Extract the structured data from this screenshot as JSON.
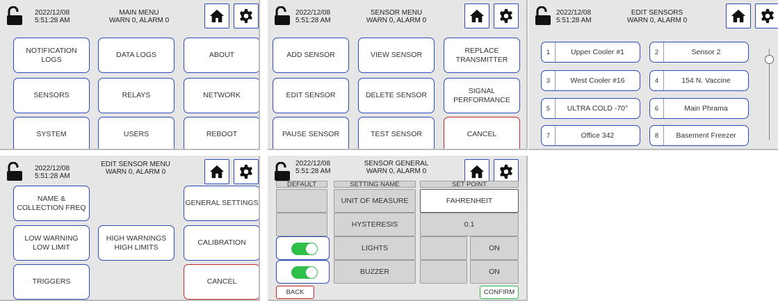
{
  "colors": {
    "accent": "#2d4bb8",
    "cancel_border": "#c62828",
    "toggle_on": "#2fbf4a",
    "panel_bg": "#e6e6e6"
  },
  "icons": {
    "lock": "unlocked-padlock-icon",
    "home": "home-icon",
    "settings": "gear-icon"
  },
  "status": {
    "date": "2022/12/08",
    "time": "5:51:28 AM",
    "warn_alarm": "WARN 0, ALARM 0"
  },
  "main_menu": {
    "title": "MAIN MENU",
    "buttons": [
      "NOTIFICATION\nLOGS",
      "DATA LOGS",
      "ABOUT",
      "SENSORS",
      "RELAYS",
      "NETWORK",
      "SYSTEM",
      "USERS",
      "REBOOT"
    ]
  },
  "sensor_menu": {
    "title": "SENSOR MENU",
    "buttons": [
      "ADD SENSOR",
      "VIEW SENSOR",
      "REPLACE\nTRANSMITTER",
      "EDIT SENSOR",
      "DELETE SENSOR",
      "SIGNAL\nPERFORMANCE",
      "PAUSE SENSOR",
      "TEST SENSOR",
      "CANCEL"
    ]
  },
  "edit_sensors": {
    "title": "EDIT SENSORS",
    "sensors": [
      {
        "num": "1",
        "name": "Upper Cooler #1"
      },
      {
        "num": "2",
        "name": "Sensor 2"
      },
      {
        "num": "3",
        "name": "West Cooler #16"
      },
      {
        "num": "4",
        "name": "154 N. Vaccine"
      },
      {
        "num": "5",
        "name": "ULTRA COLD -70°"
      },
      {
        "num": "6",
        "name": "Main Phrama"
      },
      {
        "num": "7",
        "name": "Office 342"
      },
      {
        "num": "8",
        "name": "Basement Freezer"
      }
    ]
  },
  "edit_sensor_menu": {
    "title": "EDIT SENSOR MENU",
    "buttons": [
      "NAME &\nCOLLECTION FREQ",
      "GENERAL SETTINGS",
      "LOW WARNING\nLOW LIMIT",
      "HIGH WARNINGS\nHIGH LIMITS",
      "CALIBRATION",
      "TRIGGERS",
      "CANCEL"
    ]
  },
  "sensor_general": {
    "title": "SENSOR GENERAL",
    "columns": [
      "DEFAULT",
      "SETTING NAME",
      "SET POINT"
    ],
    "rows": [
      {
        "name": "UNIT OF MEASURE",
        "value": "FAHRENHEIT"
      },
      {
        "name": "HYSTERESIS",
        "value": "0.1"
      },
      {
        "name": "LIGHTS",
        "value": "ON",
        "toggle": true
      },
      {
        "name": "BUZZER",
        "value": "ON",
        "toggle": true
      }
    ],
    "back_label": "BACK",
    "confirm_label": "CONFIRM"
  }
}
